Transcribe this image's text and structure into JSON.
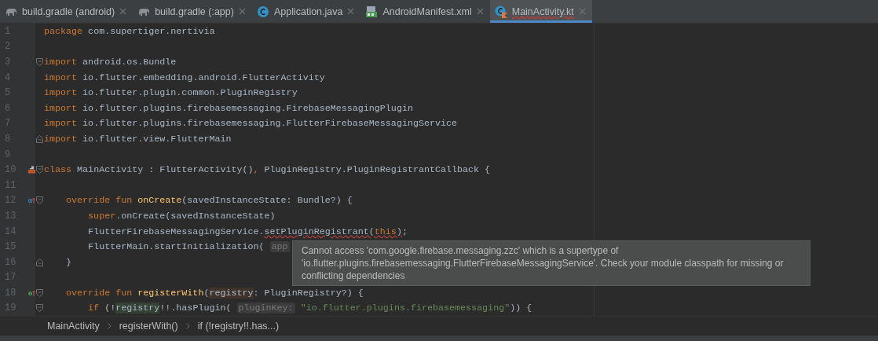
{
  "tabs": [
    {
      "label": "build.gradle (android)",
      "kind": "gradle",
      "selected": false,
      "errors": false
    },
    {
      "label": "build.gradle (:app)",
      "kind": "gradle",
      "selected": false,
      "errors": false
    },
    {
      "label": "Application.java",
      "kind": "java",
      "selected": false,
      "errors": false
    },
    {
      "label": "AndroidManifest.xml",
      "kind": "manifest",
      "selected": false,
      "errors": false
    },
    {
      "label": "MainActivity.kt",
      "kind": "kotlin",
      "selected": true,
      "errors": true
    }
  ],
  "editor": {
    "lines": [
      {
        "number": "1",
        "tokens": [
          {
            "text": "package",
            "kind": "keyword"
          },
          {
            "text": " com.supertiger.nertivia",
            "kind": "plain"
          }
        ]
      },
      {
        "number": "2"
      },
      {
        "number": "3",
        "gutter": [
          {
            "kind": "fold-start"
          }
        ],
        "tokens": [
          {
            "text": "import",
            "kind": "keyword"
          },
          {
            "text": " android.os.Bundle",
            "kind": "plain"
          }
        ]
      },
      {
        "number": "4",
        "tokens": [
          {
            "text": "import",
            "kind": "keyword"
          },
          {
            "text": " io.flutter.embedding.android.FlutterActivity",
            "kind": "plain"
          }
        ]
      },
      {
        "number": "5",
        "tokens": [
          {
            "text": "import",
            "kind": "keyword"
          },
          {
            "text": " io.flutter.plugin.common.PluginRegistry",
            "kind": "plain"
          }
        ]
      },
      {
        "number": "6",
        "tokens": [
          {
            "text": "import",
            "kind": "keyword"
          },
          {
            "text": " io.flutter.plugins.firebasemessaging.FirebaseMessagingPlugin",
            "kind": "plain"
          }
        ]
      },
      {
        "number": "7",
        "tokens": [
          {
            "text": "import",
            "kind": "keyword"
          },
          {
            "text": " io.flutter.plugins.firebasemessaging.FlutterFirebaseMessagingService",
            "kind": "plain"
          }
        ]
      },
      {
        "number": "8",
        "gutter": [
          {
            "kind": "fold-end"
          }
        ],
        "tokens": [
          {
            "text": "import",
            "kind": "keyword"
          },
          {
            "text": " io.flutter.view.FlutterMain",
            "kind": "plain"
          }
        ]
      },
      {
        "number": "9"
      },
      {
        "number": "10",
        "gutter": [
          {
            "kind": "class"
          },
          {
            "kind": "fold-start"
          }
        ],
        "tokens": [
          {
            "text": "class",
            "kind": "keyword"
          },
          {
            "text": " MainActivity : FlutterActivity()",
            "kind": "plain"
          },
          {
            "text": ",",
            "kind": "keyword"
          },
          {
            "text": " PluginRegistry.PluginRegistrantCallback {",
            "kind": "plain"
          }
        ]
      },
      {
        "number": "11"
      },
      {
        "number": "12",
        "gutter": [
          {
            "kind": "overrides"
          },
          {
            "kind": "fold-start"
          }
        ],
        "tokens": [
          {
            "text": "    override fun ",
            "kind": "keyword"
          },
          {
            "text": "onCreate",
            "kind": "function"
          },
          {
            "text": "(savedInstanceState: Bundle?) {",
            "kind": "plain"
          }
        ]
      },
      {
        "number": "13",
        "tokens": [
          {
            "text": "        super",
            "kind": "keyword"
          },
          {
            "text": ".onCreate(savedInstanceState)",
            "kind": "plain"
          }
        ]
      },
      {
        "number": "14",
        "tokens": [
          {
            "text": "        FlutterFirebaseMessagingService.",
            "kind": "plain"
          },
          {
            "text": "setPluginRegistrant(",
            "kind": "plain",
            "error": true
          },
          {
            "text": "this",
            "kind": "keyword",
            "error": true
          },
          {
            "text": ")",
            "kind": "plain",
            "error": true
          },
          {
            "text": ";",
            "kind": "plain"
          }
        ]
      },
      {
        "number": "15",
        "tokens": [
          {
            "text": "        FlutterMain.startInitialization( ",
            "kind": "plain"
          },
          {
            "text": "app",
            "kind": "hint"
          }
        ]
      },
      {
        "number": "16",
        "gutter": [
          {
            "kind": "fold-end"
          }
        ],
        "tokens": [
          {
            "text": "    }",
            "kind": "plain"
          }
        ]
      },
      {
        "number": "17"
      },
      {
        "number": "18",
        "gutter": [
          {
            "kind": "implements"
          },
          {
            "kind": "fold-start"
          }
        ],
        "tokens": [
          {
            "text": "    override fun ",
            "kind": "keyword"
          },
          {
            "text": "registerWith",
            "kind": "function"
          },
          {
            "text": "(",
            "kind": "plain"
          },
          {
            "text": "registry",
            "kind": "write-usage"
          },
          {
            "text": ": PluginRegistry?) {",
            "kind": "plain"
          }
        ]
      },
      {
        "number": "19",
        "gutter": [
          {
            "kind": "fold-start"
          }
        ],
        "tokens": [
          {
            "text": "        if",
            "kind": "keyword"
          },
          {
            "text": " (!",
            "kind": "plain"
          },
          {
            "text": "registry",
            "kind": "read-usage"
          },
          {
            "text": "!!.hasPlugin( ",
            "kind": "plain"
          },
          {
            "text": "pluginKey:",
            "kind": "hint"
          },
          {
            "text": " \"io.flutter.plugins.firebasemessaging\"",
            "kind": "string"
          },
          {
            "text": ")) {",
            "kind": "plain"
          }
        ]
      }
    ],
    "tooltip": {
      "text": "Cannot access 'com.google.firebase.messaging.zzc' which is a supertype of 'io.flutter.plugins.firebasemessaging.FlutterFirebaseMessagingService'. Check your module classpath for missing or conflicting dependencies"
    }
  },
  "breadcrumbs": [
    "MainActivity",
    "registerWith()",
    "if (!registry!!.has...)"
  ]
}
